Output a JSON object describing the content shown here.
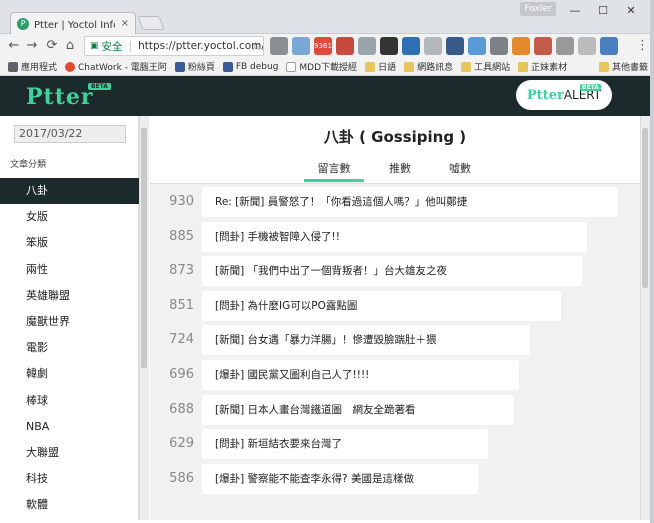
{
  "browser": {
    "tab_title": "Ptter | Yoctol Info. 優拓資",
    "tab_favicon": "P",
    "tab_close": "×",
    "user_badge": "Foxler",
    "win_min": "—",
    "win_max": "☐",
    "win_close": "✕",
    "nav_back": "←",
    "nav_forward": "→",
    "nav_reload": "⟳",
    "nav_home": "⌂",
    "secure_label": "安全",
    "url": "https://ptter.yoctol.com/Go",
    "star": "☆",
    "ext_badge": "9361",
    "menu": "⋮"
  },
  "bookmarks": [
    {
      "label": "應用程式",
      "icon": "apps-icon",
      "color": "#5f6368"
    },
    {
      "label": "ChatWork - 電腦王阿",
      "icon": "chatwork-icon",
      "color": "#e24a2c"
    },
    {
      "label": "粉絲頁",
      "icon": "facebook-icon",
      "color": "#3b5998"
    },
    {
      "label": "FB debug",
      "icon": "facebook-icon",
      "color": "#3b5998"
    },
    {
      "label": "MDD下載授經",
      "icon": "doc-icon",
      "color": "#9aa0a6"
    },
    {
      "label": "日語",
      "icon": "folder-icon",
      "color": "#e8c45c"
    },
    {
      "label": "網路訊息",
      "icon": "folder-icon",
      "color": "#e8c45c"
    },
    {
      "label": "工具網站",
      "icon": "folder-icon",
      "color": "#e8c45c"
    },
    {
      "label": "正妹素材",
      "icon": "folder-icon",
      "color": "#e8c45c"
    }
  ],
  "bookmarks_other": "其他書籤",
  "site": {
    "logo": "Ptter",
    "beta": "BETA",
    "alert_logo": "Ptter",
    "alert_text": "ALERT",
    "alert_beta": "BETA"
  },
  "sidebar": {
    "date": "2017/03/22",
    "category_label": "文章分類",
    "items": [
      "八卦",
      "女版",
      "笨版",
      "兩性",
      "英雄聯盟",
      "魔獸世界",
      "電影",
      "韓劇",
      "棒球",
      "NBA",
      "大聯盟",
      "科技",
      "軟體"
    ]
  },
  "board": {
    "title": "八卦 ( Gossiping )",
    "tabs": [
      "留言數",
      "推數",
      "噓數"
    ]
  },
  "posts": [
    {
      "count": "930",
      "title": "Re: [新聞] 員警怒了！「你看過這個人嗎？」他叫鄭捷",
      "width": 0.8
    },
    {
      "count": "885",
      "title": "[問卦] 手機被智障入侵了!!",
      "width": 0.74
    },
    {
      "count": "873",
      "title": "[新聞] 「我們中出了一個背叛者！」台大雄友之夜",
      "width": 0.73
    },
    {
      "count": "851",
      "title": "[問卦] 為什麼IG可以PO露點圖",
      "width": 0.69
    },
    {
      "count": "724",
      "title": "[新聞] 台女遇「暴力洋腸」！慘遭毀臉踹肚＋猥",
      "width": 0.63
    },
    {
      "count": "696",
      "title": "[爆卦] 國民黨又圖利自己人了!!!!",
      "width": 0.61
    },
    {
      "count": "688",
      "title": "[新聞] 日本人畫台灣鐵道圖　網友全跪著看",
      "width": 0.6
    },
    {
      "count": "629",
      "title": "[問卦] 新垣結衣要來台灣了",
      "width": 0.55
    },
    {
      "count": "586",
      "title": "[爆卦] 警察能不能查李永得? 美國是這樣做",
      "width": 0.53
    }
  ]
}
